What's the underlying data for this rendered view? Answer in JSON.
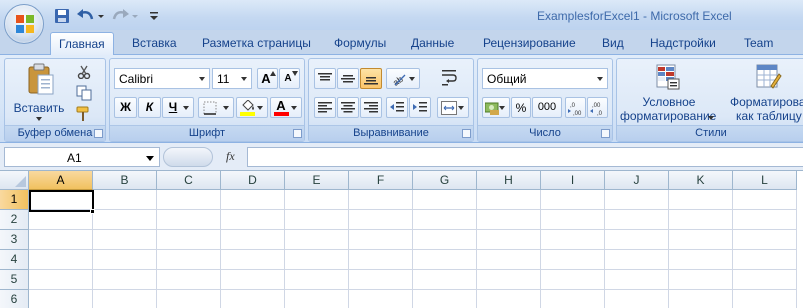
{
  "window": {
    "title": "ExamplesforExcel1 - Microsoft Excel"
  },
  "quick_access": {
    "icons": [
      "save-icon",
      "undo-icon",
      "redo-icon",
      "customize-arrow-icon"
    ]
  },
  "tabs": [
    {
      "label": "Главная",
      "active": true
    },
    {
      "label": "Вставка"
    },
    {
      "label": "Разметка страницы"
    },
    {
      "label": "Формулы"
    },
    {
      "label": "Данные"
    },
    {
      "label": "Рецензирование"
    },
    {
      "label": "Вид"
    },
    {
      "label": "Надстройки"
    },
    {
      "label": "Team"
    }
  ],
  "ribbon": {
    "clipboard": {
      "label": "Буфер обмена",
      "paste_label": "Вставить"
    },
    "font": {
      "label": "Шрифт",
      "font_name": "Calibri",
      "font_size": "11",
      "bold": "Ж",
      "italic": "К",
      "underline": "Ч",
      "grow": "A",
      "shrink": "A",
      "font_color_letter": "A",
      "highlight_color": "#ffff00",
      "font_color": "#ff0000"
    },
    "alignment": {
      "label": "Выравнивание"
    },
    "number": {
      "label": "Число",
      "format": "Общий",
      "percent": "%",
      "thousands": "000",
      "inc_decimal": ",0 ,00",
      "dec_decimal": ",00 ,0"
    },
    "styles": {
      "label": "Стили",
      "conditional_line1": "Условное",
      "conditional_line2": "форматирование",
      "table_line1": "Форматирова",
      "table_line2": "как таблицу"
    }
  },
  "formula_bar": {
    "name_box": "A1",
    "fx": "fx",
    "value": ""
  },
  "grid": {
    "columns": [
      "A",
      "B",
      "C",
      "D",
      "E",
      "F",
      "G",
      "H",
      "I",
      "J",
      "K",
      "L"
    ],
    "rows": [
      "1",
      "2",
      "3",
      "4",
      "5",
      "6"
    ],
    "selected_cell": "A1",
    "header_color": "#dde6f1",
    "selection_color": "#f1c15f"
  }
}
